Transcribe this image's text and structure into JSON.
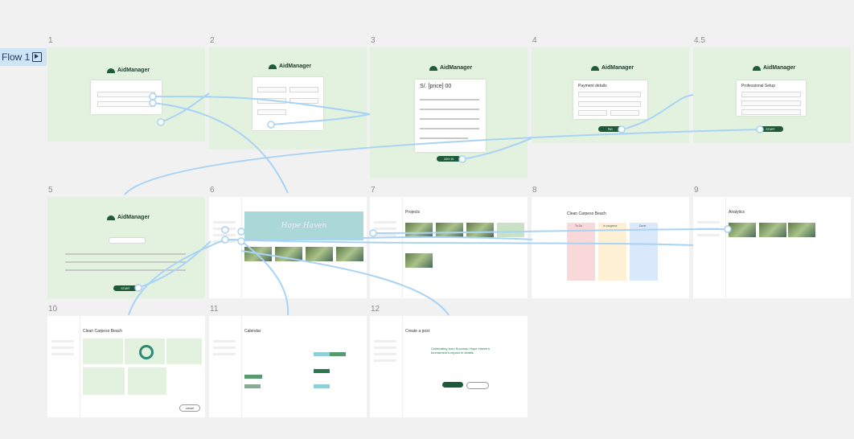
{
  "flow": {
    "label": "Flow 1",
    "icon": "play-frame-icon"
  },
  "frames": [
    {
      "id": "1",
      "brand": "AidManager"
    },
    {
      "id": "2",
      "brand": "AidManager"
    },
    {
      "id": "3",
      "brand": "AidManager",
      "price": "S/. [price] 00",
      "button": "JOIN IN"
    },
    {
      "id": "4",
      "brand": "AidManager",
      "heading": "Payment details",
      "button": "PAY"
    },
    {
      "id": "4.5",
      "brand": "AidManager",
      "heading": "Professional Setup",
      "button": "START"
    },
    {
      "id": "5",
      "brand": "AidManager",
      "button": "START"
    },
    {
      "id": "6",
      "hero": "Hope Haven"
    },
    {
      "id": "7",
      "title": "Projects"
    },
    {
      "id": "8",
      "title": "Clean Carpeso Beach",
      "columns": [
        "To Do",
        "In progress",
        "Done"
      ]
    },
    {
      "id": "9",
      "title": "Analytics"
    },
    {
      "id": "10",
      "title": "Clean Carpeso Beach",
      "button": "cancel"
    },
    {
      "id": "11",
      "title": "Calendar"
    },
    {
      "id": "12",
      "title": "Create a post",
      "headline": "Celebrating from Success: Hope Haven's tournament's impact in details"
    }
  ],
  "colors": {
    "frame_green": "#e3f1df",
    "connector": "#a9d3f5",
    "brand_green": "#1e5a3a",
    "canvas": "#f1f1f1"
  }
}
